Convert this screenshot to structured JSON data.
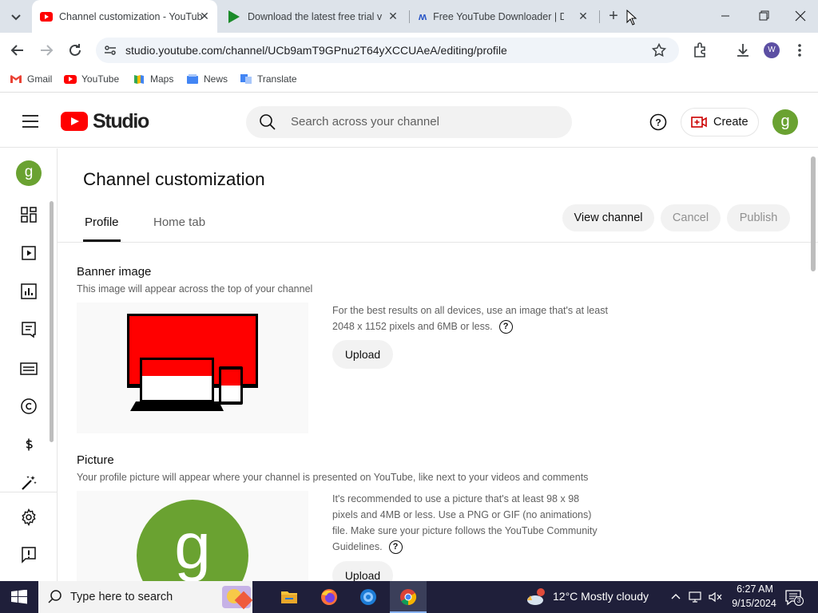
{
  "browser": {
    "tabs": [
      {
        "title": "Channel customization - YouTube Studio",
        "active": true
      },
      {
        "title": "Download the latest free trial version",
        "active": false
      },
      {
        "title": "Free YouTube Downloader | Download",
        "active": false
      }
    ],
    "url": "studio.youtube.com/channel/UCb9amT9GPnu2T64yXCCUAeA/editing/profile",
    "profile_initial": "W",
    "bookmarks": [
      "Gmail",
      "YouTube",
      "Maps",
      "News",
      "Translate"
    ]
  },
  "studio": {
    "logo_text": "Studio",
    "search_placeholder": "Search across your channel",
    "create_label": "Create",
    "avatar_initial": "g"
  },
  "page": {
    "title": "Channel customization",
    "tabs": [
      "Profile",
      "Home tab"
    ],
    "actions": {
      "view_channel": "View channel",
      "cancel": "Cancel",
      "publish": "Publish"
    },
    "banner": {
      "title": "Banner image",
      "desc": "This image will appear across the top of your channel",
      "info": "For the best results on all devices, use an image that's at least 2048 x 1152 pixels and 6MB or less.",
      "upload": "Upload"
    },
    "picture": {
      "title": "Picture",
      "desc": "Your profile picture will appear where your channel is presented on YouTube, like next to your videos and comments",
      "info": "It's recommended to use a picture that's at least 98 x 98 pixels and 4MB or less. Use a PNG or GIF (no animations) file. Make sure your picture follows the YouTube Community Guidelines.",
      "upload": "Upload",
      "avatar_initial": "g"
    }
  },
  "taskbar": {
    "search_placeholder": "Type here to search",
    "weather": "12°C  Mostly cloudy",
    "time": "6:27 AM",
    "date": "9/15/2024",
    "notifications": "3"
  },
  "colors": {
    "yt_red": "#ff0000",
    "avatar_green": "#6aa231",
    "taskbar": "#1f1f3a"
  }
}
